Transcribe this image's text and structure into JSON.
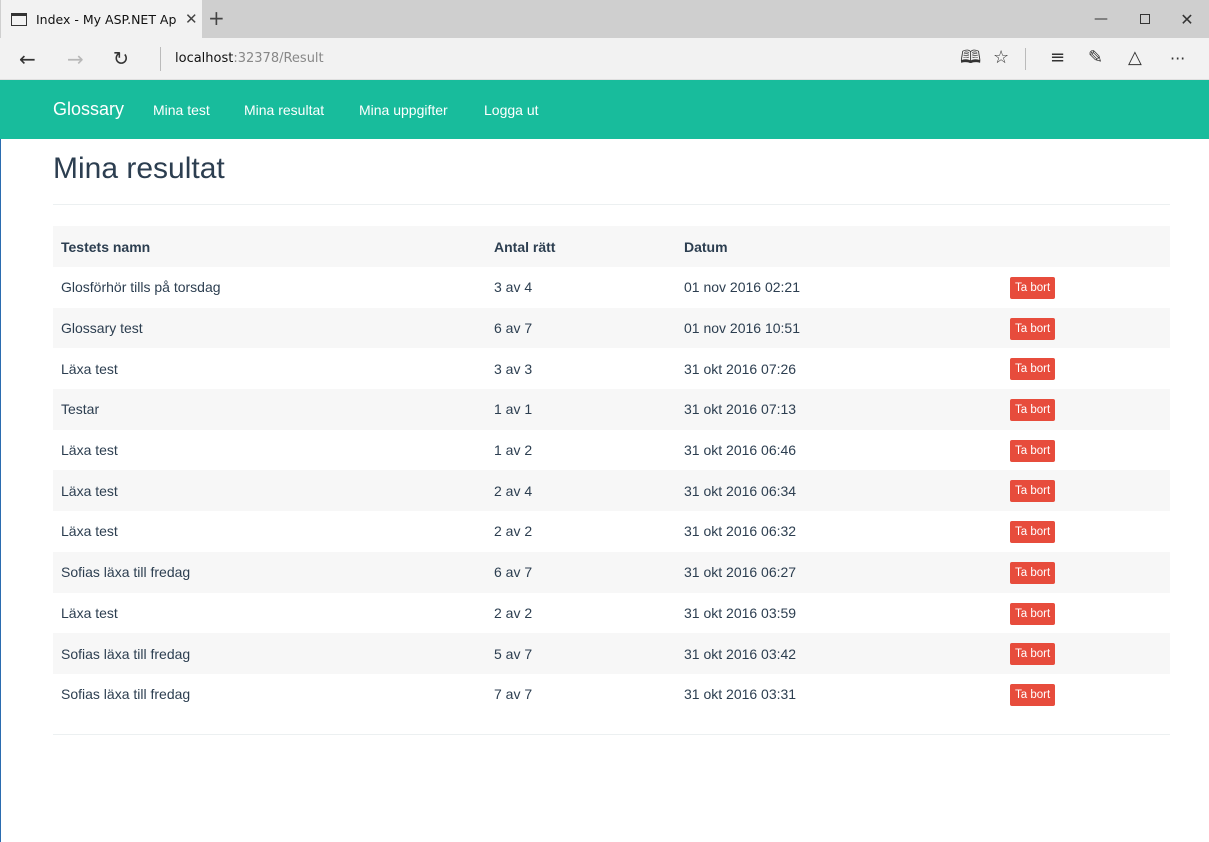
{
  "browser": {
    "tab_title": "Index - My ASP.NET Ap",
    "tab_close": "✕",
    "new_tab": "+",
    "address_host": "localhost",
    "address_path": ":32378/Result",
    "icons": [
      "reading-view-icon",
      "favorite-star-icon",
      "hub-icon",
      "web-note-icon",
      "share-icon",
      "more-icon"
    ]
  },
  "navbar": {
    "brand": "Glossary",
    "links": [
      "Mina test",
      "Mina resultat",
      "Mina uppgifter",
      "Logga ut"
    ],
    "color": "#18bc9c"
  },
  "page": {
    "title": "Mina resultat"
  },
  "table": {
    "headers": [
      "Testets namn",
      "Antal rätt",
      "Datum"
    ],
    "delete_label": "Ta bort",
    "delete_color": "#e74c3c",
    "rows": [
      {
        "name": "Glosförhör tills på torsdag",
        "score": "3 av 4",
        "date": "01 nov 2016 02:21"
      },
      {
        "name": "Glossary test",
        "score": "6 av 7",
        "date": "01 nov 2016 10:51"
      },
      {
        "name": "Läxa test",
        "score": "3 av 3",
        "date": "31 okt 2016 07:26"
      },
      {
        "name": "Testar",
        "score": "1 av 1",
        "date": "31 okt 2016 07:13"
      },
      {
        "name": "Läxa test",
        "score": "1 av 2",
        "date": "31 okt 2016 06:46"
      },
      {
        "name": "Läxa test",
        "score": "2 av 4",
        "date": "31 okt 2016 06:34"
      },
      {
        "name": "Läxa test",
        "score": "2 av 2",
        "date": "31 okt 2016 06:32"
      },
      {
        "name": "Sofias läxa till fredag",
        "score": "6 av 7",
        "date": "31 okt 2016 06:27"
      },
      {
        "name": "Läxa test",
        "score": "2 av 2",
        "date": "31 okt 2016 03:59"
      },
      {
        "name": "Sofias läxa till fredag",
        "score": "5 av 7",
        "date": "31 okt 2016 03:42"
      },
      {
        "name": "Sofias läxa till fredag",
        "score": "7 av 7",
        "date": "31 okt 2016 03:31"
      }
    ]
  }
}
